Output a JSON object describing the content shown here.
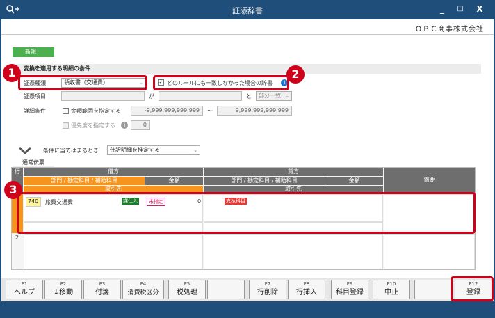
{
  "window": {
    "title": "証憑辞書",
    "minimize": "_",
    "maximize": "□",
    "close": "X"
  },
  "company": "ＯＢＣ商事株式会社",
  "new_label": "新規",
  "conditions": {
    "section_title": "変換を適用する明細の条件",
    "type_label": "証憑種類",
    "type_value": "領収書（交通費）",
    "fallback_checkbox_label": "どのルールにも一致しなかった場合の辞書",
    "fallback_checked": "✓",
    "item_label": "証憑項目",
    "ga": "が",
    "to": "と",
    "match_value": "部分一致",
    "detail_label": "詳細条件",
    "amount_range_label": "金額範囲を指定する",
    "amount_min": "-9,999,999,999,999",
    "tilde": "～",
    "amount_max": "9,999,999,999,999",
    "priority_label": "優先度を指定する",
    "priority_value": "0"
  },
  "rule": {
    "label": "条件に当てはまるとき",
    "value": "仕訳明細を推定する"
  },
  "tab": "通常伝票",
  "grid": {
    "row_header": "行",
    "debit": "借方",
    "credit": "貸方",
    "debit_account": "部門 / 勘定科目 / 補助科目",
    "debit_amount": "金額",
    "credit_account": "部門 / 勘定科目 / 補助科目",
    "credit_amount": "金額",
    "debit_partner": "取引先",
    "credit_partner": "取引先",
    "summary": "摘要",
    "row2": "2",
    "line": {
      "code": "740",
      "account": "旅費交通費",
      "tax": "課仕入",
      "tax_status": "未指定",
      "amount": "0",
      "credit_tag": "支払科目"
    }
  },
  "fkeys": [
    {
      "key": "F1",
      "label": "ヘルプ"
    },
    {
      "key": "F2",
      "label": "↓移動"
    },
    {
      "key": "F3",
      "label": "付箋"
    },
    {
      "key": "F4",
      "label": "消費税区分"
    },
    {
      "key": "F5",
      "label": "税処理"
    },
    {
      "key": "",
      "label": ""
    },
    {
      "key": "F7",
      "label": "行削除"
    },
    {
      "key": "F8",
      "label": "行挿入"
    },
    {
      "key": "F9",
      "label": "科目登録"
    },
    {
      "key": "F10",
      "label": "中止"
    },
    {
      "key": "",
      "label": ""
    },
    {
      "key": "F12",
      "label": "登録"
    }
  ],
  "callouts": [
    "1",
    "2",
    "3"
  ],
  "colors": {
    "accent_orange": "#f7941d",
    "callout_red": "#d0021b",
    "titlebar": "#1e4e79"
  }
}
